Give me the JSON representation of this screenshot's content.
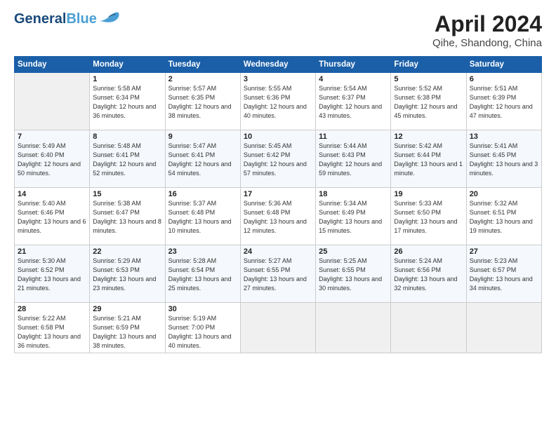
{
  "header": {
    "logo_general": "General",
    "logo_blue": "Blue",
    "title": "April 2024",
    "location": "Qihe, Shandong, China"
  },
  "days_of_week": [
    "Sunday",
    "Monday",
    "Tuesday",
    "Wednesday",
    "Thursday",
    "Friday",
    "Saturday"
  ],
  "weeks": [
    [
      {
        "day": "",
        "empty": true
      },
      {
        "day": "1",
        "sunrise": "Sunrise: 5:58 AM",
        "sunset": "Sunset: 6:34 PM",
        "daylight": "Daylight: 12 hours and 36 minutes."
      },
      {
        "day": "2",
        "sunrise": "Sunrise: 5:57 AM",
        "sunset": "Sunset: 6:35 PM",
        "daylight": "Daylight: 12 hours and 38 minutes."
      },
      {
        "day": "3",
        "sunrise": "Sunrise: 5:55 AM",
        "sunset": "Sunset: 6:36 PM",
        "daylight": "Daylight: 12 hours and 40 minutes."
      },
      {
        "day": "4",
        "sunrise": "Sunrise: 5:54 AM",
        "sunset": "Sunset: 6:37 PM",
        "daylight": "Daylight: 12 hours and 43 minutes."
      },
      {
        "day": "5",
        "sunrise": "Sunrise: 5:52 AM",
        "sunset": "Sunset: 6:38 PM",
        "daylight": "Daylight: 12 hours and 45 minutes."
      },
      {
        "day": "6",
        "sunrise": "Sunrise: 5:51 AM",
        "sunset": "Sunset: 6:39 PM",
        "daylight": "Daylight: 12 hours and 47 minutes."
      }
    ],
    [
      {
        "day": "7",
        "sunrise": "Sunrise: 5:49 AM",
        "sunset": "Sunset: 6:40 PM",
        "daylight": "Daylight: 12 hours and 50 minutes."
      },
      {
        "day": "8",
        "sunrise": "Sunrise: 5:48 AM",
        "sunset": "Sunset: 6:41 PM",
        "daylight": "Daylight: 12 hours and 52 minutes."
      },
      {
        "day": "9",
        "sunrise": "Sunrise: 5:47 AM",
        "sunset": "Sunset: 6:41 PM",
        "daylight": "Daylight: 12 hours and 54 minutes."
      },
      {
        "day": "10",
        "sunrise": "Sunrise: 5:45 AM",
        "sunset": "Sunset: 6:42 PM",
        "daylight": "Daylight: 12 hours and 57 minutes."
      },
      {
        "day": "11",
        "sunrise": "Sunrise: 5:44 AM",
        "sunset": "Sunset: 6:43 PM",
        "daylight": "Daylight: 12 hours and 59 minutes."
      },
      {
        "day": "12",
        "sunrise": "Sunrise: 5:42 AM",
        "sunset": "Sunset: 6:44 PM",
        "daylight": "Daylight: 13 hours and 1 minute."
      },
      {
        "day": "13",
        "sunrise": "Sunrise: 5:41 AM",
        "sunset": "Sunset: 6:45 PM",
        "daylight": "Daylight: 13 hours and 3 minutes."
      }
    ],
    [
      {
        "day": "14",
        "sunrise": "Sunrise: 5:40 AM",
        "sunset": "Sunset: 6:46 PM",
        "daylight": "Daylight: 13 hours and 6 minutes."
      },
      {
        "day": "15",
        "sunrise": "Sunrise: 5:38 AM",
        "sunset": "Sunset: 6:47 PM",
        "daylight": "Daylight: 13 hours and 8 minutes."
      },
      {
        "day": "16",
        "sunrise": "Sunrise: 5:37 AM",
        "sunset": "Sunset: 6:48 PM",
        "daylight": "Daylight: 13 hours and 10 minutes."
      },
      {
        "day": "17",
        "sunrise": "Sunrise: 5:36 AM",
        "sunset": "Sunset: 6:48 PM",
        "daylight": "Daylight: 13 hours and 12 minutes."
      },
      {
        "day": "18",
        "sunrise": "Sunrise: 5:34 AM",
        "sunset": "Sunset: 6:49 PM",
        "daylight": "Daylight: 13 hours and 15 minutes."
      },
      {
        "day": "19",
        "sunrise": "Sunrise: 5:33 AM",
        "sunset": "Sunset: 6:50 PM",
        "daylight": "Daylight: 13 hours and 17 minutes."
      },
      {
        "day": "20",
        "sunrise": "Sunrise: 5:32 AM",
        "sunset": "Sunset: 6:51 PM",
        "daylight": "Daylight: 13 hours and 19 minutes."
      }
    ],
    [
      {
        "day": "21",
        "sunrise": "Sunrise: 5:30 AM",
        "sunset": "Sunset: 6:52 PM",
        "daylight": "Daylight: 13 hours and 21 minutes."
      },
      {
        "day": "22",
        "sunrise": "Sunrise: 5:29 AM",
        "sunset": "Sunset: 6:53 PM",
        "daylight": "Daylight: 13 hours and 23 minutes."
      },
      {
        "day": "23",
        "sunrise": "Sunrise: 5:28 AM",
        "sunset": "Sunset: 6:54 PM",
        "daylight": "Daylight: 13 hours and 25 minutes."
      },
      {
        "day": "24",
        "sunrise": "Sunrise: 5:27 AM",
        "sunset": "Sunset: 6:55 PM",
        "daylight": "Daylight: 13 hours and 27 minutes."
      },
      {
        "day": "25",
        "sunrise": "Sunrise: 5:25 AM",
        "sunset": "Sunset: 6:55 PM",
        "daylight": "Daylight: 13 hours and 30 minutes."
      },
      {
        "day": "26",
        "sunrise": "Sunrise: 5:24 AM",
        "sunset": "Sunset: 6:56 PM",
        "daylight": "Daylight: 13 hours and 32 minutes."
      },
      {
        "day": "27",
        "sunrise": "Sunrise: 5:23 AM",
        "sunset": "Sunset: 6:57 PM",
        "daylight": "Daylight: 13 hours and 34 minutes."
      }
    ],
    [
      {
        "day": "28",
        "sunrise": "Sunrise: 5:22 AM",
        "sunset": "Sunset: 6:58 PM",
        "daylight": "Daylight: 13 hours and 36 minutes."
      },
      {
        "day": "29",
        "sunrise": "Sunrise: 5:21 AM",
        "sunset": "Sunset: 6:59 PM",
        "daylight": "Daylight: 13 hours and 38 minutes."
      },
      {
        "day": "30",
        "sunrise": "Sunrise: 5:19 AM",
        "sunset": "Sunset: 7:00 PM",
        "daylight": "Daylight: 13 hours and 40 minutes."
      },
      {
        "day": "",
        "empty": true
      },
      {
        "day": "",
        "empty": true
      },
      {
        "day": "",
        "empty": true
      },
      {
        "day": "",
        "empty": true
      }
    ]
  ]
}
